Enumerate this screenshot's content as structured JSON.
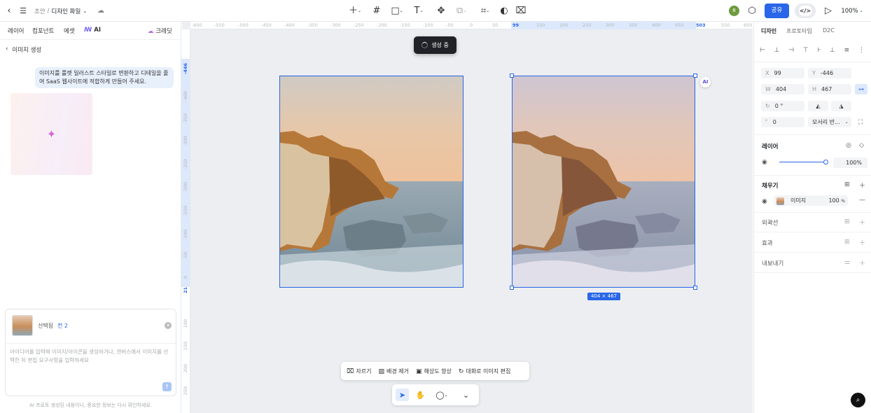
{
  "topbar": {
    "breadcrumb_root": "초안",
    "breadcrumb_sep": "/",
    "file_name": "디자인 파일",
    "share_label": "공유",
    "code_label": "</>",
    "zoom": "100%",
    "avatar_initial": "8"
  },
  "left_panel": {
    "tabs": [
      "레이어",
      "컴포넌트",
      "에셋"
    ],
    "ai_tab": "AI",
    "credit_label": "크레딧",
    "back_label": "이미지 생성",
    "user_message": "이미지를 룰렛 일러스트 스타일로 변환하고 디테일을 줄여 SaaS 웹사이트에 적합하게 만들어 주세요.",
    "selected_label": "선택됨",
    "selected_count": "컨 2",
    "input_placeholder": "아이디어를 입력해 이미지/아이콘을 생성하거나, 캔버스에서 이미지를 선택한 뒤 편집 요구사항을 입력하세요",
    "disclaimer": "AI 프로토 생성된 내용이니, 중요한 정보는 다시 확인하세요."
  },
  "canvas": {
    "ruler_h": [
      "-600",
      "-550",
      "-500",
      "-450",
      "-400",
      "-350",
      "-300",
      "-250",
      "-200",
      "-150",
      "-100",
      "-50",
      "0",
      "50",
      "99",
      "150",
      "200",
      "250",
      "300",
      "350",
      "400",
      "450",
      "503",
      "550",
      "600"
    ],
    "ruler_h_highlight": [
      "99",
      "503"
    ],
    "ruler_v": [
      "-446",
      "-400",
      "-350",
      "-300",
      "-250",
      "-200",
      "-150",
      "-100",
      "-50",
      "0",
      "21",
      "100",
      "150",
      "200",
      "250"
    ],
    "ruler_v_highlight": [
      "-446",
      "21"
    ],
    "generating_label": "생성 중",
    "dimension_badge": "404 × 467",
    "ai_badge": "AI",
    "image_toolbar": [
      {
        "icon": "crop-icon",
        "label": "자르기"
      },
      {
        "icon": "remove-bg-icon",
        "label": "배경 제거"
      },
      {
        "icon": "upscale-icon",
        "label": "해상도 향상"
      },
      {
        "icon": "chat-edit-icon",
        "label": "대화로 이미지 편집"
      }
    ]
  },
  "right_panel": {
    "tabs": [
      "디자인",
      "프로토타입",
      "D2C"
    ],
    "x_label": "X",
    "x_value": "99",
    "y_label": "Y",
    "y_value": "-446",
    "w_label": "W",
    "w_value": "404",
    "h_label": "H",
    "h_value": "467",
    "rotation_value": "0 °",
    "radius_value": "0",
    "corner_label": "모서리 반...",
    "layer_title": "레이어",
    "opacity_value": "100%",
    "fill_title": "채우기",
    "fill_type": "이미지",
    "fill_opacity": "100",
    "fill_opacity_unit": "%",
    "stroke_title": "외곽선",
    "effect_title": "효과",
    "export_title": "내보내기"
  },
  "colors": {
    "accent": "#2a66e8",
    "canvas_bg": "#eceef1",
    "bubble_bg": "#e8f0fc"
  }
}
